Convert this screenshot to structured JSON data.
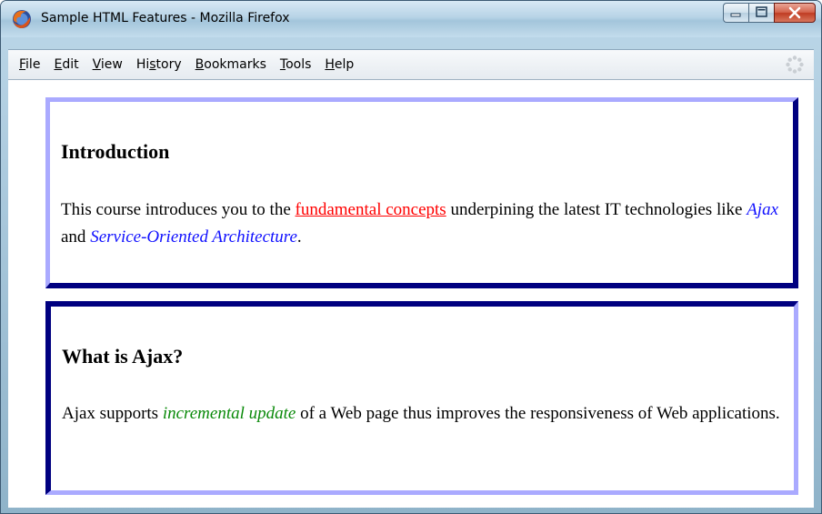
{
  "window": {
    "title": "Sample HTML Features - Mozilla Firefox"
  },
  "menu": {
    "items": [
      {
        "label": "File",
        "access": "F",
        "rest": "ile"
      },
      {
        "label": "Edit",
        "access": "E",
        "rest": "dit"
      },
      {
        "label": "View",
        "access": "V",
        "rest": "iew"
      },
      {
        "label": "History",
        "pre": "Hi",
        "access": "s",
        "rest": "tory"
      },
      {
        "label": "Bookmarks",
        "access": "B",
        "rest": "ookmarks"
      },
      {
        "label": "Tools",
        "access": "T",
        "rest": "ools"
      },
      {
        "label": "Help",
        "access": "H",
        "rest": "elp"
      }
    ]
  },
  "sections": [
    {
      "heading": "Introduction",
      "text_before": "This course introduces you to the ",
      "link": "fundamental concepts",
      "text_middle": " underpining the latest IT technologies like ",
      "em1": "Ajax",
      "text_and": " and ",
      "em2": "Service-Oriented Architecture",
      "text_end": "."
    },
    {
      "heading": "What is Ajax?",
      "text_before": "Ajax supports ",
      "em": "incremental update",
      "text_after": " of a Web page thus improves the responsiveness of Web applications."
    }
  ],
  "colors": {
    "border_light": "#aaaaff",
    "border_dark": "#000080",
    "link_red": "#ff0000",
    "emphasis_blue": "#1010ff",
    "emphasis_green": "#0a8a0a"
  },
  "icons": {
    "app": "firefox-icon",
    "minimize": "minimize-icon",
    "maximize": "maximize-icon",
    "close": "close-icon",
    "throbber": "throbber-icon"
  }
}
